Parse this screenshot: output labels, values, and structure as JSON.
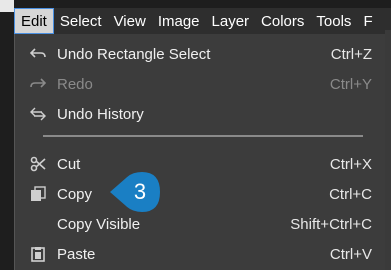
{
  "menubar": {
    "items": [
      "Edit",
      "Select",
      "View",
      "Image",
      "Layer",
      "Colors",
      "Tools",
      "F"
    ]
  },
  "menu": {
    "items": [
      {
        "icon": "undo-icon",
        "label": "Undo Rectangle Select",
        "shortcut": "Ctrl+Z",
        "enabled": true
      },
      {
        "icon": "redo-icon",
        "label": "Redo",
        "shortcut": "Ctrl+Y",
        "enabled": false
      },
      {
        "icon": "undo-history-icon",
        "label": "Undo History",
        "shortcut": "",
        "enabled": true
      },
      {
        "icon": "cut-icon",
        "label": "Cut",
        "shortcut": "Ctrl+X",
        "enabled": true
      },
      {
        "icon": "copy-icon",
        "label": "Copy",
        "shortcut": "Ctrl+C",
        "enabled": true
      },
      {
        "icon": "",
        "label": "Copy Visible",
        "shortcut": "Shift+Ctrl+C",
        "enabled": true
      },
      {
        "icon": "paste-icon",
        "label": "Paste",
        "shortcut": "Ctrl+V",
        "enabled": true
      }
    ]
  },
  "callout": {
    "number": "3",
    "color": "#1a7fc4"
  }
}
